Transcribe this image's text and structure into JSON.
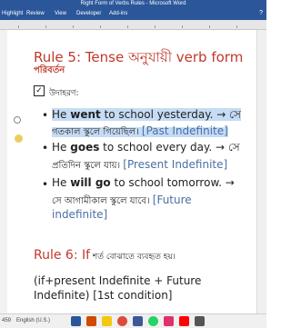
{
  "window": {
    "title": "Right Form of Verbs Rules  -  Microsoft Word",
    "ribbon_tabs": [
      "Highlight",
      "Review",
      "View",
      "Developer",
      "Add-ins"
    ]
  },
  "rule5": {
    "title": "Rule 5: Tense অনুযায়ী verb form",
    "subtitle": "পরিবর্তন",
    "example_label": "উদাহরণ:"
  },
  "examples": [
    {
      "part1": "He ",
      "verb": "went",
      "part2": " to school yesterday. → সে",
      "bengali": "গতকাল স্কুলে গিয়েছিল।",
      "tag": "[Past Indefinite]"
    },
    {
      "part1": "He ",
      "verb": "goes",
      "part2": " to school every day. → সে",
      "bengali": "প্রতিদিন স্কুলে যায়।",
      "tag": "[Present Indefinite]"
    },
    {
      "part1": "He ",
      "verb": "will go",
      "part2": " to school tomorrow. →",
      "bengali": "সে আগামীকাল স্কুলে যাবে।",
      "tag_line1": "[Future",
      "tag_line2": "indefinite]"
    }
  ],
  "rule6": {
    "title": "Rule 6: If",
    "title_bn": " শর্ত বোঝাতে ব্যবহৃত হয়।",
    "line1": "(if+present Indefinite + Future",
    "line2": "Indefinite) [1st condition]"
  },
  "statusbar": {
    "page_info": "459",
    "language": "English (U.S.)"
  },
  "colors": {
    "word_blue": "#2b579a",
    "rule_red": "#c0392b",
    "highlight": "#c6dcf5",
    "tag_blue": "#4a6fa5"
  }
}
